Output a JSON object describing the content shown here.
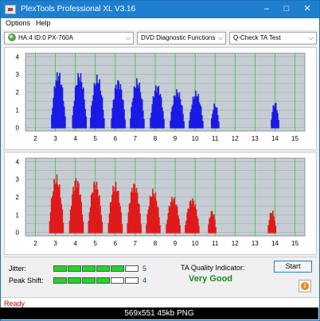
{
  "window": {
    "title": "PlexTools Professional XL V3.16",
    "colors": {
      "titlebar": "#1e7fd0",
      "plot_bg": "#c6cdd3",
      "grid_green": "#1fc61f",
      "blue_bars": "#1a1ae6",
      "red_bars": "#e01a1a"
    }
  },
  "menu": {
    "options": "Options",
    "help": "Help"
  },
  "toolbar": {
    "drive": "HA:4 ID:0  PX-760A",
    "function": "DVD Diagnostic Functions",
    "test": "Q-Check TA Test"
  },
  "chart_data": [
    {
      "type": "bar",
      "series": [
        {
          "name": "",
          "color": "#1a1ae6"
        }
      ],
      "x_ticks": [
        2,
        3,
        4,
        5,
        6,
        7,
        8,
        9,
        10,
        11,
        12,
        13,
        14,
        15
      ],
      "y_ticks": [
        0,
        0.5,
        1,
        1.5,
        2,
        2.5,
        3,
        3.5,
        4
      ],
      "xlim": [
        1.5,
        15.5
      ],
      "ylim": [
        -0.2,
        4.2
      ],
      "grid": true,
      "peaks": [
        {
          "center": 3.15,
          "height": 3.25
        },
        {
          "center": 4.2,
          "height": 3.2
        },
        {
          "center": 5.1,
          "height": 3.0
        },
        {
          "center": 6.15,
          "height": 2.8
        },
        {
          "center": 7.1,
          "height": 2.8
        },
        {
          "center": 8.1,
          "height": 2.5
        },
        {
          "center": 9.1,
          "height": 2.2
        },
        {
          "center": 10.05,
          "height": 2.1
        },
        {
          "center": 11.0,
          "height": 1.4
        },
        {
          "center": 14.0,
          "height": 1.5
        }
      ]
    },
    {
      "type": "bar",
      "series": [
        {
          "name": "",
          "color": "#e01a1a"
        }
      ],
      "x_ticks": [
        2,
        3,
        4,
        5,
        6,
        7,
        8,
        9,
        10,
        11,
        12,
        13,
        14,
        15
      ],
      "y_ticks": [
        0,
        0.5,
        1,
        1.5,
        2,
        2.5,
        3,
        3.5,
        4
      ],
      "xlim": [
        1.5,
        15.5
      ],
      "ylim": [
        -0.2,
        4.2
      ],
      "grid": true,
      "peaks": [
        {
          "center": 3.05,
          "height": 3.3
        },
        {
          "center": 4.05,
          "height": 3.2
        },
        {
          "center": 5.0,
          "height": 3.0
        },
        {
          "center": 6.0,
          "height": 2.9
        },
        {
          "center": 6.95,
          "height": 2.9
        },
        {
          "center": 7.9,
          "height": 2.5
        },
        {
          "center": 8.9,
          "height": 2.1
        },
        {
          "center": 9.85,
          "height": 2.0
        },
        {
          "center": 10.85,
          "height": 1.3
        },
        {
          "center": 13.85,
          "height": 1.3
        }
      ]
    }
  ],
  "metrics": {
    "jitter_label": "Jitter:",
    "jitter_value": "5",
    "jitter_level": 5,
    "peak_label": "Peak Shift:",
    "peak_value": "4",
    "peak_level": 4,
    "meter_max": 6
  },
  "ta": {
    "label": "TA Quality Indicator:",
    "result": "Very Good"
  },
  "buttons": {
    "start": "Start"
  },
  "status": {
    "text": "Ready"
  },
  "caption": "569x551  45kb  PNG"
}
